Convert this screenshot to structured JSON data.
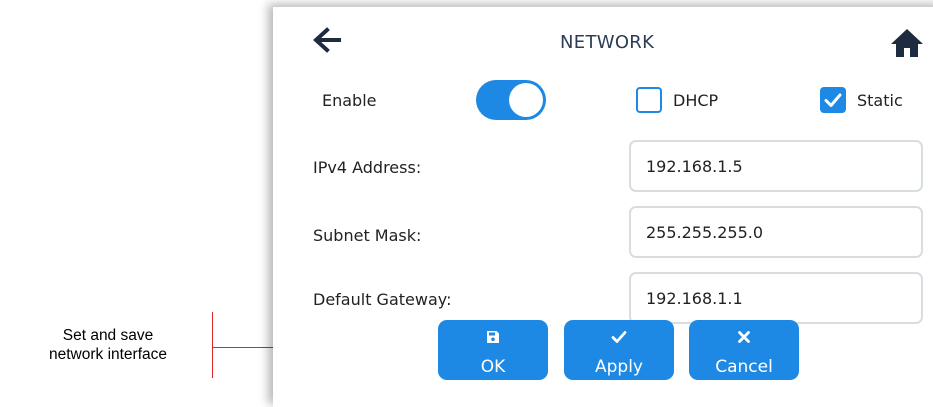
{
  "annotation": {
    "line1": "Set and save",
    "line2": "network interface"
  },
  "header": {
    "title": "NETWORK",
    "back_icon": "arrow-left-icon",
    "home_icon": "home-icon"
  },
  "enable": {
    "label": "Enable",
    "on": true
  },
  "mode": {
    "dhcp_label": "DHCP",
    "dhcp_checked": false,
    "static_label": "Static",
    "static_checked": true
  },
  "fields": {
    "ipv4_label": "IPv4 Address:",
    "ipv4_value": "192.168.1.5",
    "subnet_label": "Subnet Mask:",
    "subnet_value": "255.255.255.0",
    "gateway_label": "Default Gateway:",
    "gateway_value": "192.168.1.1"
  },
  "buttons": {
    "ok_label": "OK",
    "ok_icon": "save-icon",
    "apply_label": "Apply",
    "apply_icon": "check-icon",
    "cancel_label": "Cancel",
    "cancel_icon": "close-icon"
  },
  "colors": {
    "accent": "#1e88e5",
    "title": "#2c3d55",
    "callout_line": "#e0242a"
  }
}
